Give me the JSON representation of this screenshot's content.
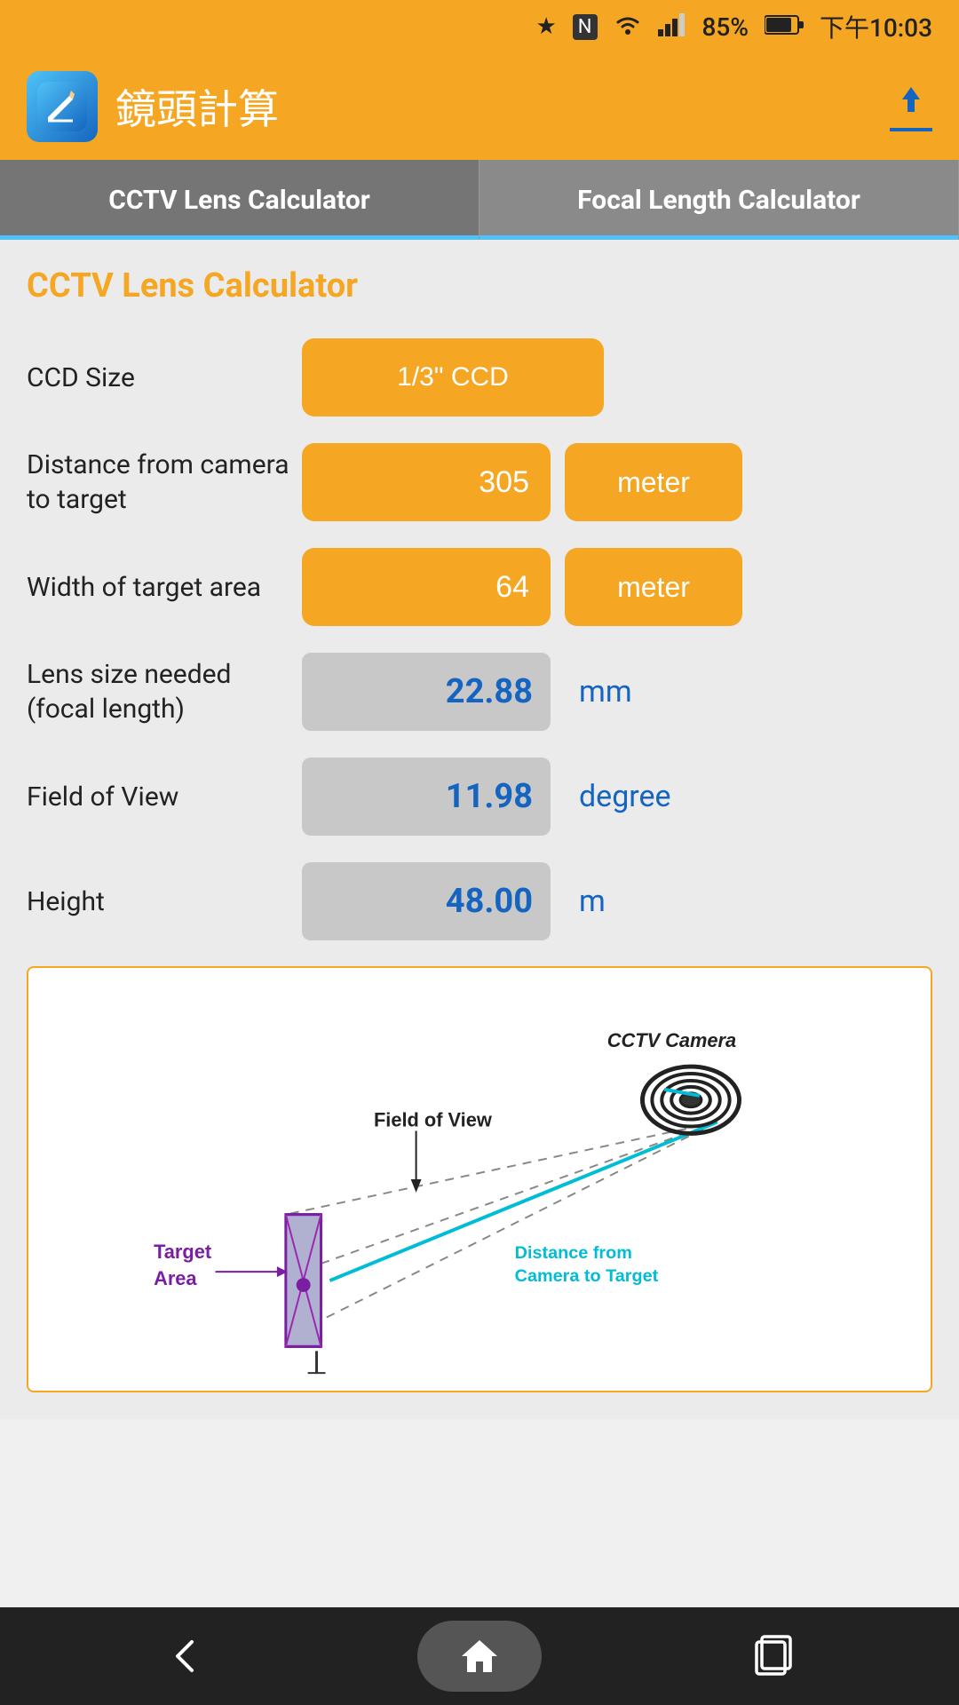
{
  "statusBar": {
    "battery": "85%",
    "time": "下午10:03"
  },
  "header": {
    "title": "鏡頭計算",
    "uploadLabel": "upload"
  },
  "tabs": [
    {
      "id": "cctv",
      "label": "CCTV Lens Calculator",
      "active": false
    },
    {
      "id": "focal",
      "label": "Focal Length Calculator",
      "active": true
    }
  ],
  "sectionTitle": "CCTV Lens Calculator",
  "fields": {
    "ccdSize": {
      "label": "CCD Size",
      "value": "1/3\" CCD"
    },
    "distance": {
      "label": "Distance from camera to target",
      "value": "305",
      "unit": "meter"
    },
    "width": {
      "label": "Width of target area",
      "value": "64",
      "unit": "meter"
    },
    "lensSize": {
      "label": "Lens size needed (focal length)",
      "value": "22.88",
      "unit": "mm"
    },
    "fieldOfView": {
      "label": "Field of View",
      "value": "11.98",
      "unit": "degree"
    },
    "height": {
      "label": "Height",
      "value": "48.00",
      "unit": "m"
    }
  },
  "diagram": {
    "cameraLabel": "CCTV Camera",
    "fieldOfViewLabel": "Field of View",
    "targetLabel": "Target\nArea",
    "distanceLabel": "Distance from\nCamera to Target"
  },
  "navBar": {
    "backIcon": "◁",
    "homeIcon": "⌂",
    "squaresIcon": "☐"
  }
}
